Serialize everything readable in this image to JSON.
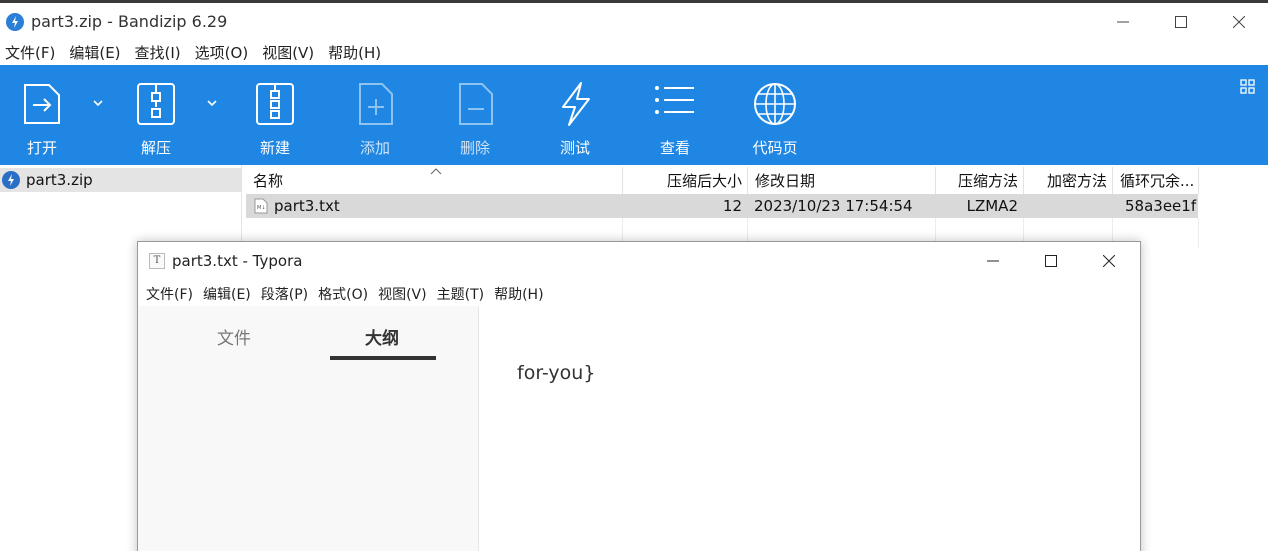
{
  "bandizip": {
    "title": "part3.zip - Bandizip 6.29",
    "menu": [
      "文件(F)",
      "编辑(E)",
      "查找(I)",
      "选项(O)",
      "视图(V)",
      "帮助(H)"
    ],
    "toolbar": {
      "open": "打开",
      "extract": "解压",
      "new": "新建",
      "add": "添加",
      "delete": "删除",
      "test": "测试",
      "view": "查看",
      "codepage": "代码页"
    },
    "tree": {
      "root": "part3.zip"
    },
    "columns": {
      "name": "名称",
      "compressed_size": "压缩后大小",
      "modified": "修改日期",
      "method": "压缩方法",
      "encryption": "加密方法",
      "crc": "循环冗余..."
    },
    "files": [
      {
        "name": "part3.txt",
        "compressed_size": "12",
        "modified": "2023/10/23 17:54:54",
        "method": "LZMA2",
        "encryption": "",
        "crc": "58a3ee1f"
      }
    ]
  },
  "typora": {
    "title": "part3.txt - Typora",
    "icon_letter": "T",
    "menu": [
      "文件(F)",
      "编辑(E)",
      "段落(P)",
      "格式(O)",
      "视图(V)",
      "主题(T)",
      "帮助(H)"
    ],
    "sidebar": {
      "tab_files": "文件",
      "tab_outline": "大纲",
      "active_tab": "大纲"
    },
    "content": "for-you}"
  },
  "colors": {
    "toolbar_bg": "#1f86e3",
    "selected_row": "#d9d9d9",
    "typora_sidebar": "#f8f8f8"
  },
  "icons": [
    "bandizip-app-icon",
    "open-icon",
    "extract-icon",
    "new-archive-icon",
    "add-icon",
    "delete-icon",
    "test-icon",
    "view-icon",
    "codepage-globe-icon",
    "layout-grid-icon",
    "zip-file-icon",
    "text-file-icon",
    "minimize-icon",
    "maximize-icon",
    "close-icon"
  ]
}
